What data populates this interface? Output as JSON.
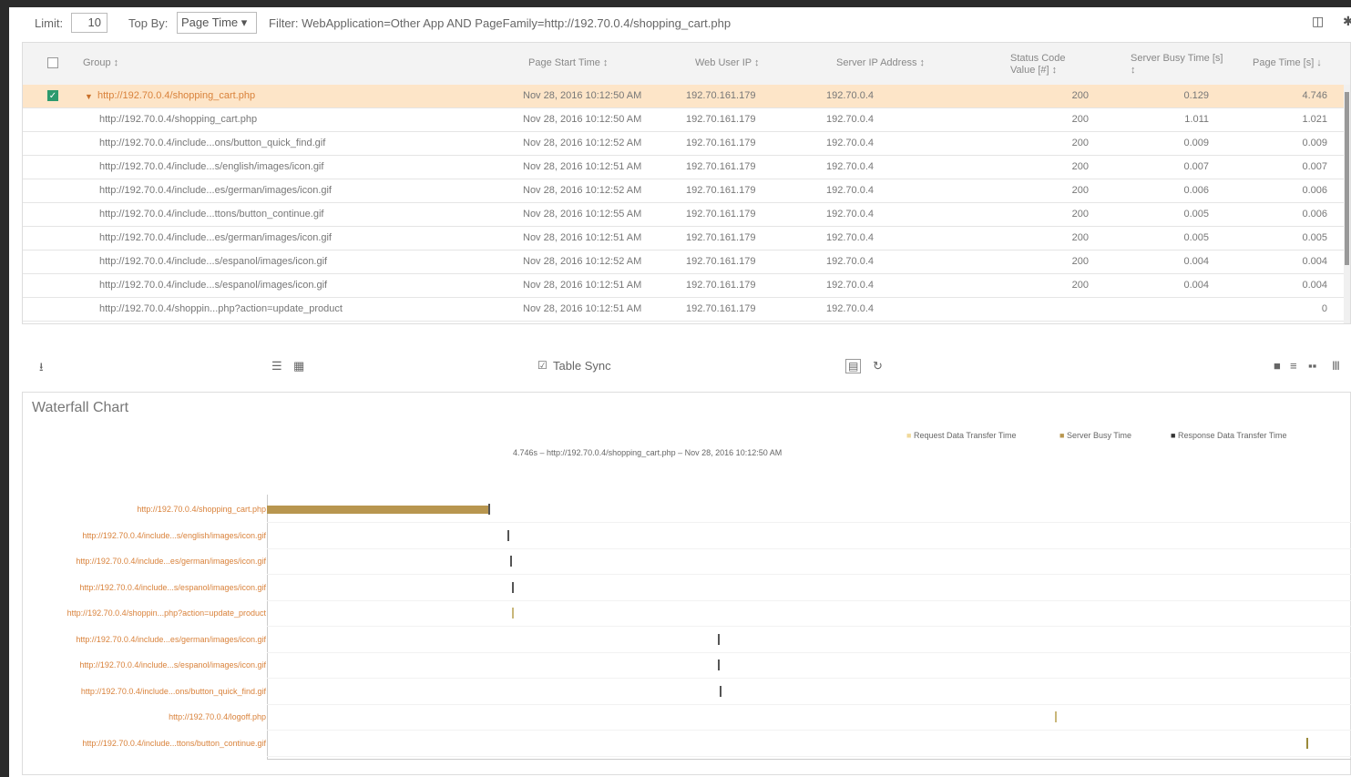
{
  "toolbar": {
    "limit_label": "Limit:",
    "limit_value": "10",
    "topby_label": "Top By:",
    "topby_value": "Page Time ▾",
    "filter_text": "Filter: WebApplication=Other App AND PageFamily=http://192.70.0.4/shopping_cart.php"
  },
  "table": {
    "headers": {
      "group": "Group ↕",
      "page_start": "Page Start Time ↕",
      "web_user_ip": "Web User IP ↕",
      "server_ip": "Server IP Address ↕",
      "status_code": "Status Code Value [#] ↕",
      "server_busy": "Server Busy Time [s] ↕",
      "page_time": "Page Time [s] ↓"
    },
    "group_row": {
      "group": "http://192.70.0.4/shopping_cart.php",
      "page_start": "Nov 28, 2016 10:12:50 AM",
      "web_user_ip": "192.70.161.179",
      "server_ip": "192.70.0.4",
      "status_code": "200",
      "server_busy": "0.129",
      "page_time": "4.746"
    },
    "rows": [
      {
        "group": "http://192.70.0.4/shopping_cart.php",
        "page_start": "Nov 28, 2016 10:12:50 AM",
        "web_user_ip": "192.70.161.179",
        "server_ip": "192.70.0.4",
        "status_code": "200",
        "server_busy": "1.011",
        "page_time": "1.021"
      },
      {
        "group": "http://192.70.0.4/include...ons/button_quick_find.gif",
        "page_start": "Nov 28, 2016 10:12:52 AM",
        "web_user_ip": "192.70.161.179",
        "server_ip": "192.70.0.4",
        "status_code": "200",
        "server_busy": "0.009",
        "page_time": "0.009"
      },
      {
        "group": "http://192.70.0.4/include...s/english/images/icon.gif",
        "page_start": "Nov 28, 2016 10:12:51 AM",
        "web_user_ip": "192.70.161.179",
        "server_ip": "192.70.0.4",
        "status_code": "200",
        "server_busy": "0.007",
        "page_time": "0.007"
      },
      {
        "group": "http://192.70.0.4/include...es/german/images/icon.gif",
        "page_start": "Nov 28, 2016 10:12:52 AM",
        "web_user_ip": "192.70.161.179",
        "server_ip": "192.70.0.4",
        "status_code": "200",
        "server_busy": "0.006",
        "page_time": "0.006"
      },
      {
        "group": "http://192.70.0.4/include...ttons/button_continue.gif",
        "page_start": "Nov 28, 2016 10:12:55 AM",
        "web_user_ip": "192.70.161.179",
        "server_ip": "192.70.0.4",
        "status_code": "200",
        "server_busy": "0.005",
        "page_time": "0.006"
      },
      {
        "group": "http://192.70.0.4/include...es/german/images/icon.gif",
        "page_start": "Nov 28, 2016 10:12:51 AM",
        "web_user_ip": "192.70.161.179",
        "server_ip": "192.70.0.4",
        "status_code": "200",
        "server_busy": "0.005",
        "page_time": "0.005"
      },
      {
        "group": "http://192.70.0.4/include...s/espanol/images/icon.gif",
        "page_start": "Nov 28, 2016 10:12:52 AM",
        "web_user_ip": "192.70.161.179",
        "server_ip": "192.70.0.4",
        "status_code": "200",
        "server_busy": "0.004",
        "page_time": "0.004"
      },
      {
        "group": "http://192.70.0.4/include...s/espanol/images/icon.gif",
        "page_start": "Nov 28, 2016 10:12:51 AM",
        "web_user_ip": "192.70.161.179",
        "server_ip": "192.70.0.4",
        "status_code": "200",
        "server_busy": "0.004",
        "page_time": "0.004"
      },
      {
        "group": "http://192.70.0.4/shoppin...php?action=update_product",
        "page_start": "Nov 28, 2016 10:12:51 AM",
        "web_user_ip": "192.70.161.179",
        "server_ip": "192.70.0.4",
        "status_code": "",
        "server_busy": "",
        "page_time": "0"
      }
    ]
  },
  "midbar": {
    "table_sync_label": "Table Sync"
  },
  "chart": {
    "title": "Waterfall Chart",
    "legend": [
      "Request Data Transfer Time",
      "Server Busy Time",
      "Response Data Transfer Time"
    ],
    "legend_colors": [
      "#f0d99a",
      "#b8964f",
      "#333333"
    ],
    "subtitle": "4.746s – http://192.70.0.4/shopping_cart.php – Nov 28, 2016 10:12:50 AM"
  },
  "chart_data": {
    "type": "bar",
    "title": "Waterfall Chart",
    "subtitle": "4.746s – http://192.70.0.4/shopping_cart.php – Nov 28, 2016 10:12:50 AM",
    "xlim": [
      0,
      4.746
    ],
    "categories": [
      "http://192.70.0.4/shopping_cart.php",
      "http://192.70.0.4/include...s/english/images/icon.gif",
      "http://192.70.0.4/include...es/german/images/icon.gif",
      "http://192.70.0.4/include...s/espanol/images/icon.gif",
      "http://192.70.0.4/shoppin...php?action=update_product",
      "http://192.70.0.4/include...es/german/images/icon.gif",
      "http://192.70.0.4/include...s/espanol/images/icon.gif",
      "http://192.70.0.4/include...ons/button_quick_find.gif",
      "http://192.70.0.4/logoff.php",
      "http://192.70.0.4/include...ttons/button_continue.gif"
    ],
    "series": [
      {
        "name": "Server Busy Time",
        "start": [
          0,
          1.1,
          1.11,
          1.12,
          1.12,
          2.06,
          2.06,
          2.07,
          3.6,
          4.75
        ],
        "values": [
          1.011,
          0.007,
          0.006,
          0.004,
          0,
          0.005,
          0.004,
          0.009,
          0.002,
          0.005
        ]
      }
    ]
  }
}
